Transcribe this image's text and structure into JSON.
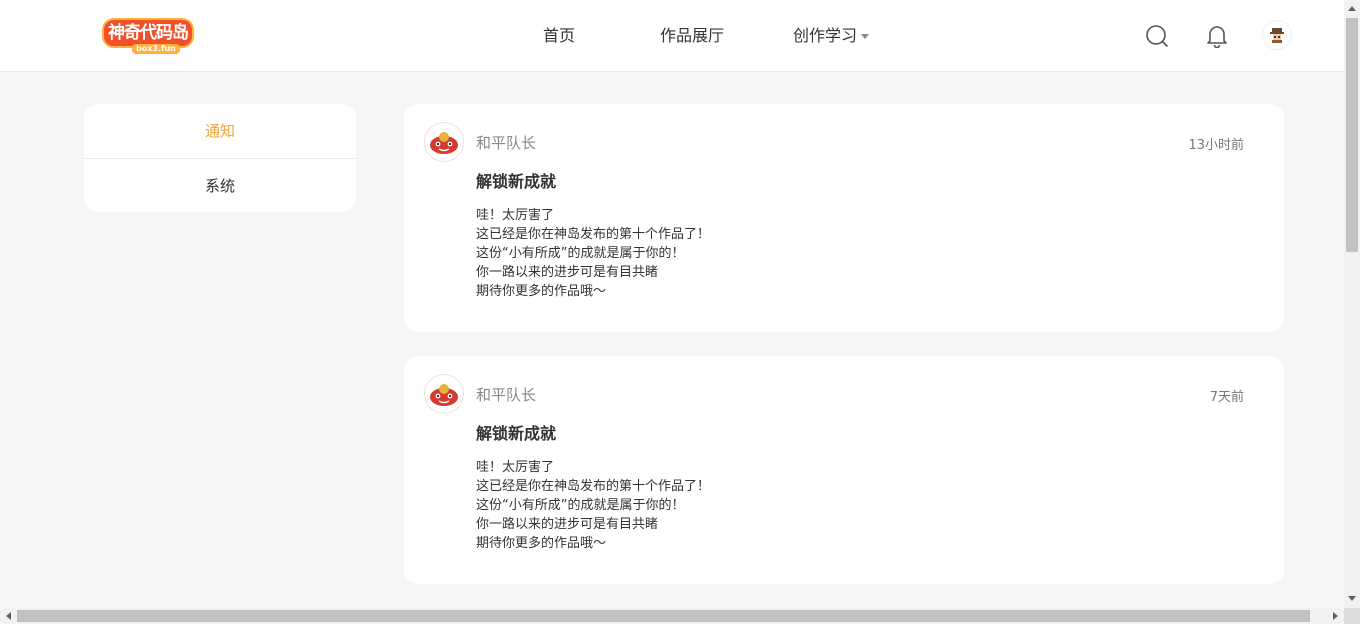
{
  "header": {
    "logo": {
      "text": "神奇代码岛",
      "sub": "box3.fun",
      "icon": "logo-icon"
    },
    "nav": [
      {
        "label": "首页"
      },
      {
        "label": "作品展厅"
      },
      {
        "label": "创作学习",
        "icon": "chevron-down-icon"
      }
    ],
    "icons": [
      "search-icon",
      "bell-icon",
      "user-avatar"
    ]
  },
  "sidebar": {
    "items": [
      {
        "label": "通知",
        "active": true
      },
      {
        "label": "系统",
        "active": false
      }
    ],
    "accent_color": "#f0a437"
  },
  "notifications": [
    {
      "sender": "和平队长",
      "time": "13小时前",
      "title": "解锁新成就",
      "lines": [
        "哇！太厉害了",
        "这已经是你在神岛发布的第十个作品了！",
        "这份“小有所成”的成就是属于你的！",
        "你一路以来的进步可是有目共睹",
        "期待你更多的作品哦～"
      ]
    },
    {
      "sender": "和平队长",
      "time": "7天前",
      "title": "解锁新成就",
      "lines": [
        "哇！太厉害了",
        "这已经是你在神岛发布的第十个作品了！",
        "这份“小有所成”的成就是属于你的！",
        "你一路以来的进步可是有目共睹",
        "期待你更多的作品哦～"
      ]
    }
  ],
  "colors": {
    "background": "#f5f5f5",
    "card": "#ffffff",
    "logo_red": "#f0512a",
    "logo_orange": "#ffb13b"
  }
}
